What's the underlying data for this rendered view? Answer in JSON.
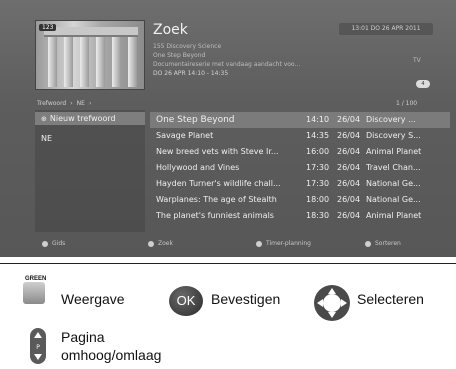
{
  "header": {
    "title": "Zoek",
    "channel_badge": "123",
    "channel": "155 Discovery Science",
    "program": "One Step Beyond",
    "description": "Documentaireserie met vandaag aandacht voo...",
    "datetime": "DO 26 APR 14:10 - 14:35",
    "clock": "13:01  DO 26 APR 2011",
    "type": "TV",
    "badge": "4"
  },
  "keyword_bar": {
    "label": "Trefwoord",
    "value": "NE"
  },
  "count": "1 / 100",
  "keywords": [
    {
      "label": "Nieuw trefwoord",
      "icon": "plus-icon"
    },
    {
      "label": "NE"
    }
  ],
  "results": [
    {
      "title": "One Step Beyond",
      "time": "14:10",
      "date": "26/04",
      "channel": "Discovery ..."
    },
    {
      "title": "Savage Planet",
      "time": "14:35",
      "date": "26/04",
      "channel": "Discovery S..."
    },
    {
      "title": "New breed vets with Steve Ir...",
      "time": "16:00",
      "date": "26/04",
      "channel": "Animal Planet"
    },
    {
      "title": "Hollywood and Vines",
      "time": "17:30",
      "date": "26/04",
      "channel": "Travel Chan..."
    },
    {
      "title": "Hayden Turner's wildlife chall...",
      "time": "17:30",
      "date": "26/04",
      "channel": "National Ge..."
    },
    {
      "title": "Warplanes: The age of Stealth",
      "time": "18:00",
      "date": "26/04",
      "channel": "National Ge..."
    },
    {
      "title": "The planet's funniest animals",
      "time": "18:30",
      "date": "26/04",
      "channel": "Animal Planet"
    }
  ],
  "footer": [
    "Gids",
    "Zoek",
    "Timer-planning",
    "Sorteren"
  ],
  "legend": {
    "green_key": "GREEN",
    "green_label": "Weergave",
    "ok_key": "OK",
    "ok_label": "Bevestigen",
    "nav_label": "Selecteren",
    "page_label_1": "Pagina",
    "page_label_2": "omhoog/omlaag"
  }
}
